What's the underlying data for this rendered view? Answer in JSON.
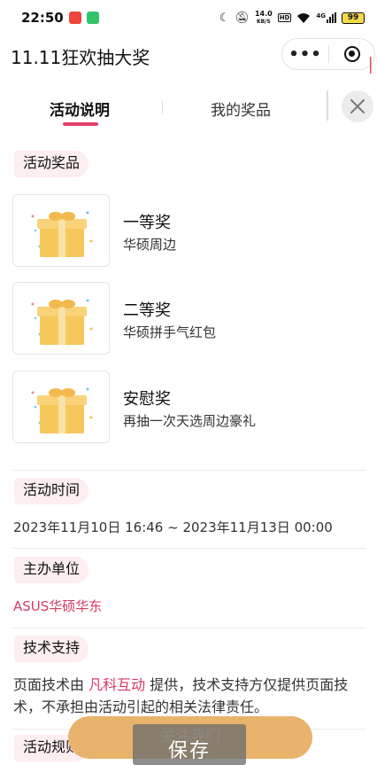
{
  "status_bar": {
    "time": "22:50",
    "net_speed_value": "14.0",
    "net_speed_unit": "KB/S",
    "hd": "HD",
    "signal": "4G",
    "battery": "99"
  },
  "header": {
    "title": "11.11狂欢抽大奖",
    "more_glyph": "•••"
  },
  "tabs": [
    {
      "label": "活动说明",
      "active": true
    },
    {
      "label": "我的奖品",
      "active": false
    }
  ],
  "prizes_section": {
    "label": "活动奖品",
    "items": [
      {
        "name": "一等奖",
        "desc": "华硕周边"
      },
      {
        "name": "二等奖",
        "desc": "华硕拼手气红包"
      },
      {
        "name": "安慰奖",
        "desc": "再抽一次天选周边豪礼"
      }
    ]
  },
  "time_section": {
    "label": "活动时间",
    "value": "2023年11月10日 16:46 ~ 2023年11月13日 00:00"
  },
  "organizer_section": {
    "label": "主办单位",
    "value": "ASUS华硕华东"
  },
  "support_section": {
    "label": "技术支持",
    "text_before": "页面技术由 ",
    "highlight": "凡科互动",
    "text_after": " 提供，技术支持方仅提供页面技术，不承担由活动引起的相关法律责任。"
  },
  "rules_section": {
    "label": "活动规则"
  },
  "follow_button": {
    "label": "关注我们"
  },
  "save_popup": {
    "label": "保存"
  },
  "colors": {
    "accent_pink": "#e83e6a",
    "link_red": "#d93a62",
    "label_bg": "#fdeef0",
    "follow_button": "#e9b36d"
  },
  "icons": [
    "more-dots-icon",
    "target-icon",
    "close-icon",
    "gift-box-icon",
    "moon-icon",
    "mute-icon",
    "wifi-icon",
    "battery-icon"
  ]
}
